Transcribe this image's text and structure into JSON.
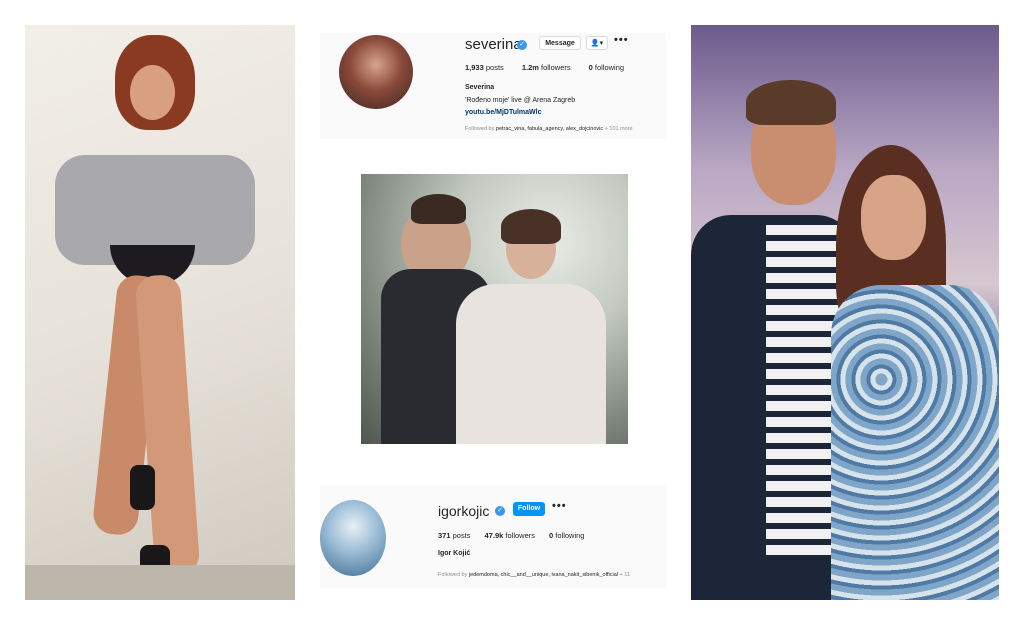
{
  "profiles": [
    {
      "username": "severina",
      "verified": true,
      "message_label": "Message",
      "people_icon": "person-add-icon",
      "more_icon": "•••",
      "posts": "1,933",
      "posts_label": "posts",
      "followers": "1.2m",
      "followers_label": "followers",
      "following": "0",
      "following_label": "following",
      "full_name": "Severina",
      "bio": "'Rođeno moje' live @ Arena Zagreb",
      "link": "youtu.be/MjDTulmaWlc",
      "followed_by_prefix": "Followed by",
      "followed_by": "petrac_vina, fabula_agency, alex_dojcinovic",
      "followed_by_more": "+ 101 more"
    },
    {
      "username": "igorkojic",
      "verified": true,
      "follow_label": "Follow",
      "more_icon": "•••",
      "posts": "371",
      "posts_label": "posts",
      "followers": "47.9k",
      "followers_label": "followers",
      "following": "0",
      "following_label": "following",
      "full_name": "Igor Kojić",
      "followed_by_prefix": "Followed by",
      "followed_by": "jedemdoma, chic__and__unique, ivana_nakit_sibenik_official",
      "followed_by_more": "+ 11"
    }
  ],
  "colors": {
    "accent": "#0095f6",
    "verified": "#3897f0",
    "link": "#00376b"
  }
}
